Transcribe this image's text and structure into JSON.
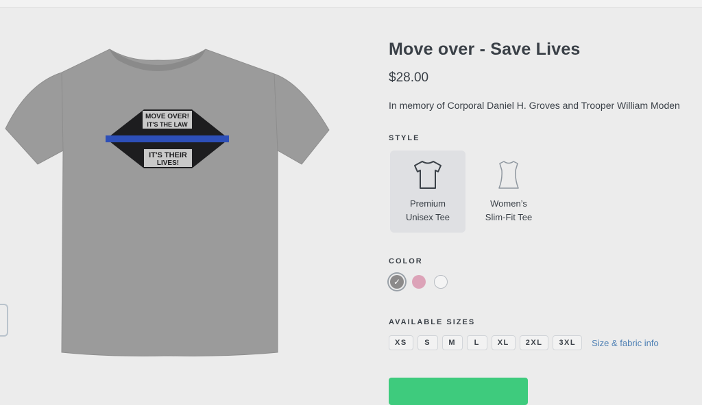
{
  "product": {
    "title": "Move over - Save Lives",
    "price": "$28.00",
    "description": "In memory of Corporal Daniel H. Groves and Trooper William Moden",
    "image": {
      "shirt_color": "#9a9a9a",
      "design_line1": "MOVE OVER!",
      "design_line2": "IT'S THE LAW",
      "design_line3": "IT'S THEIR",
      "design_line4": "LIVES!",
      "stripe_color": "#2d4fb8"
    }
  },
  "style": {
    "label": "STYLE",
    "options": [
      {
        "line1": "Premium",
        "line2": "Unisex Tee",
        "icon": "tshirt-icon",
        "selected": true
      },
      {
        "line1": "Women’s",
        "line2": "Slim-Fit Tee",
        "icon": "womens-tee-icon",
        "selected": false
      }
    ]
  },
  "color": {
    "label": "COLOR",
    "swatches": [
      {
        "name": "gray",
        "hex": "#8c8a8a",
        "selected": true
      },
      {
        "name": "pink",
        "hex": "#dca3b8",
        "selected": false
      },
      {
        "name": "white",
        "hex": "#f4f4f4",
        "selected": false
      }
    ]
  },
  "sizes": {
    "label": "AVAILABLE SIZES",
    "options": [
      "XS",
      "S",
      "M",
      "L",
      "XL",
      "2XL",
      "3XL"
    ],
    "info_link": "Size & fabric info"
  },
  "colors": {
    "accent_green": "#3ecb7d",
    "link_blue": "#4d7fb3",
    "text_dark": "#3a4047"
  }
}
